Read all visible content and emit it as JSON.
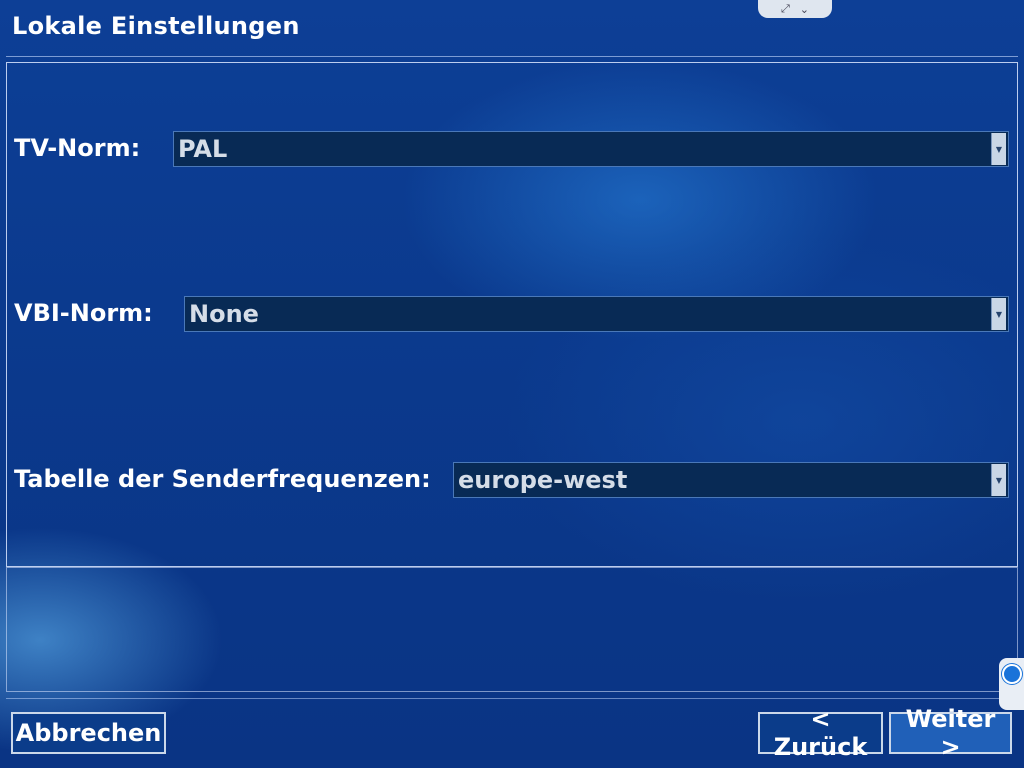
{
  "window": {
    "title": "Lokale Einstellungen"
  },
  "top_handle": {
    "expand_icon": "expand-icon",
    "chevron_icon": "chevron-down-icon"
  },
  "fields": {
    "tv_norm": {
      "label": "TV-Norm:",
      "value": "PAL"
    },
    "vbi_norm": {
      "label": "VBI-Norm:",
      "value": "None"
    },
    "frequency_table": {
      "label": "Tabelle der Senderfrequenzen:",
      "value": "europe-west"
    }
  },
  "buttons": {
    "cancel": "Abbrechen",
    "back": "< Zurück",
    "next": "Weiter >"
  }
}
